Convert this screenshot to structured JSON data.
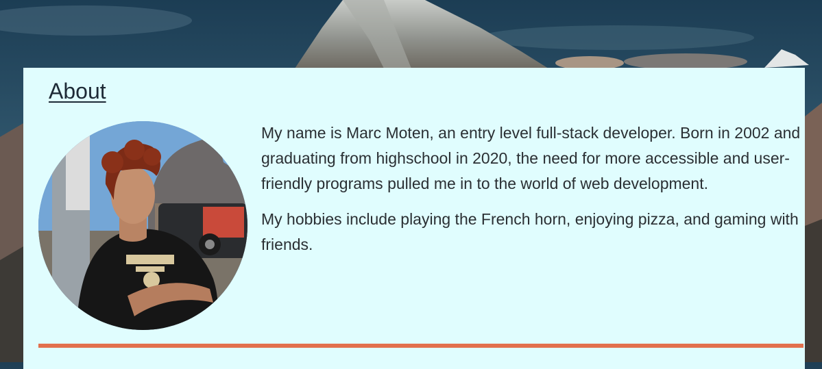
{
  "about": {
    "heading": "About",
    "paragraphs": [
      "My name is Marc Moten, an entry level full-stack developer. Born in 2002 and graduating from highschool in 2020, the need for more accessible and user-friendly programs pulled me in to the world of web development.",
      "My hobbies include playing the French horn, enjoying pizza, and gaming with friends."
    ],
    "accent_color": "#e2704d",
    "card_color": "#e0fdfe"
  }
}
